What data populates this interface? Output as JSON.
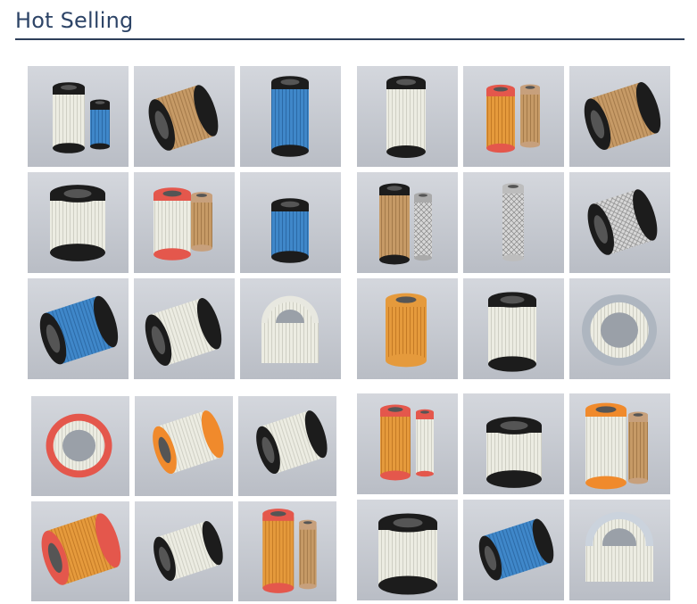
{
  "section": {
    "title": "Hot Selling"
  },
  "colors": {
    "title": "#2d4467",
    "rule": "#2e3f5a",
    "tile_background": "#c9cdd4",
    "pleat_white": "#ecece2",
    "pleat_blue": "#3f87c9",
    "pleat_brown": "#c69a66",
    "pleat_orange": "#e59a3c",
    "seal_black": "#1c1c1c",
    "cap_red": "#e4574c",
    "cap_orange": "#f08a2c",
    "kraft_paper": "#c7a07c"
  },
  "groups": [
    {
      "products": [
        {
          "icon": "air-filter-white-with-inner-blue-filter-icon"
        },
        {
          "icon": "fuel-filter-element-black-cap-icon"
        },
        {
          "icon": "blue-pleated-air-filter-icon"
        },
        {
          "icon": "white-air-filter-black-ring-icon"
        },
        {
          "icon": "white-air-filter-red-caps-pair-icon"
        },
        {
          "icon": "blue-fuel-filter-with-housing-icon"
        },
        {
          "icon": "blue-air-filter-lying-icon"
        },
        {
          "icon": "white-filter-lying-black-ends-icon"
        },
        {
          "icon": "white-round-air-filter-icon"
        }
      ]
    },
    {
      "products": [
        {
          "icon": "white-air-filter-standing-icon"
        },
        {
          "icon": "orange-air-filter-pair-icon"
        },
        {
          "icon": "mesh-air-filter-lying-icon"
        },
        {
          "icon": "brown-mesh-air-filter-pair-icon"
        },
        {
          "icon": "metal-mesh-safety-filter-icon"
        },
        {
          "icon": "black-cage-filter-lying-icon"
        },
        {
          "icon": "orange-oil-filter-element-icon"
        },
        {
          "icon": "white-filter-black-cage-top-icon"
        },
        {
          "icon": "round-panel-air-filter-icon"
        }
      ]
    },
    {
      "products": [
        {
          "icon": "red-round-air-filter-icon"
        },
        {
          "icon": "white-filter-orange-cap-lying-icon"
        },
        {
          "icon": "white-filter-black-ends-lying-icon"
        },
        {
          "icon": "yellow-air-filter-red-cap-lying-icon"
        },
        {
          "icon": "white-filter-blue-inner-lying-icon"
        },
        {
          "icon": "yellow-air-filter-red-caps-pair-icon"
        }
      ]
    },
    {
      "products": [
        {
          "icon": "orange-air-filter-red-caps-pair-icon"
        },
        {
          "icon": "white-round-filter-black-top-icon"
        },
        {
          "icon": "white-air-filter-orange-cap-pair-icon"
        },
        {
          "icon": "light-blue-filter-with-bracket-icon"
        },
        {
          "icon": "blue-mesh-filter-lying-icon"
        },
        {
          "icon": "white-round-filter-open-top-icon"
        }
      ]
    }
  ]
}
